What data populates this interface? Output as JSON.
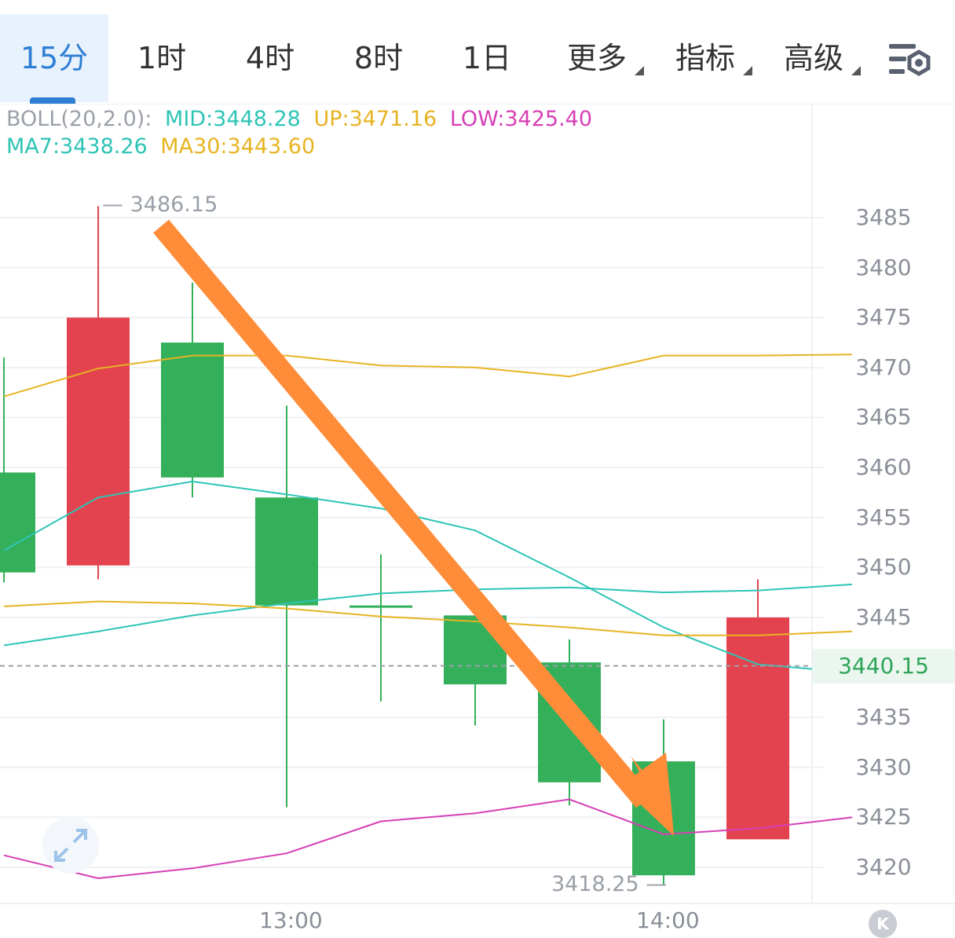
{
  "tabs": [
    {
      "label": "15分",
      "active": true
    },
    {
      "label": "1时"
    },
    {
      "label": "4时"
    },
    {
      "label": "8时"
    },
    {
      "label": "1日"
    },
    {
      "label": "更多",
      "dropdown": true
    },
    {
      "label": "指标",
      "dropdown": true
    },
    {
      "label": "高级",
      "dropdown": true
    }
  ],
  "toolbar": {
    "settings_icon": "chart-settings-icon"
  },
  "legend": {
    "boll_prefix": "BOLL(20,2.0):",
    "mid": "MID:3448.28",
    "up": "UP:3471.16",
    "low": "LOW:3425.40",
    "ma7": "MA7:3438.26",
    "ma30": "MA30:3443.60"
  },
  "colors": {
    "up_candle": "#e3434f",
    "down_candle": "#35b05a",
    "mid": "#2ec4b6",
    "up": "#e6b422",
    "low": "#d63fb5",
    "ma7": "#2ec4b6",
    "ma30": "#e6b422",
    "arrow": "#ff8c38",
    "tab_active": "#2f7fd4"
  },
  "chart_data": {
    "type": "candlestick",
    "ylim": [
      3417,
      3489
    ],
    "y_ticks": [
      3485,
      3480,
      3475,
      3470,
      3465,
      3460,
      3455,
      3450,
      3445,
      3435,
      3430,
      3425,
      3420
    ],
    "x_labels": [
      "13:00",
      "14:00"
    ],
    "last_price": "3440.15",
    "max_label": "3486.15",
    "min_label": "3418.25",
    "candles": [
      {
        "open": 3449.5,
        "close": 3459.5,
        "high": 3471,
        "low": 3448.5,
        "color": "green"
      },
      {
        "open": 3475.0,
        "close": 3450.2,
        "high": 3486.15,
        "low": 3448.8,
        "color": "red"
      },
      {
        "open": 3459.0,
        "close": 3472.5,
        "high": 3478.5,
        "low": 3457.0,
        "color": "green"
      },
      {
        "open": 3446.2,
        "close": 3457.0,
        "high": 3466.2,
        "low": 3426.0,
        "color": "green"
      },
      {
        "open": 3446.0,
        "close": 3446.2,
        "high": 3451.3,
        "low": 3436.6,
        "color": "green"
      },
      {
        "open": 3438.3,
        "close": 3445.2,
        "high": 3445.2,
        "low": 3434.2,
        "color": "green"
      },
      {
        "open": 3428.5,
        "close": 3440.5,
        "high": 3442.8,
        "low": 3426.2,
        "color": "green"
      },
      {
        "open": 3419.2,
        "close": 3430.6,
        "high": 3434.8,
        "low": 3418.25,
        "color": "green"
      },
      {
        "open": 3445.0,
        "close": 3422.8,
        "high": 3448.8,
        "low": 3422.8,
        "color": "red"
      }
    ],
    "series": [
      {
        "name": "UP",
        "values": [
          3467.1,
          3469.9,
          3471.2,
          3471.2,
          3470.2,
          3470.0,
          3469.1,
          3471.2,
          3471.2,
          3471.3
        ]
      },
      {
        "name": "MID",
        "values": [
          3442.2,
          3443.6,
          3445.2,
          3446.4,
          3447.4,
          3447.8,
          3448.0,
          3447.5,
          3447.7,
          3448.3
        ]
      },
      {
        "name": "LOW",
        "values": [
          3421.2,
          3418.9,
          3419.9,
          3421.4,
          3424.6,
          3425.4,
          3426.8,
          3423.3,
          3423.9,
          3425.0
        ]
      },
      {
        "name": "MA7",
        "values": [
          3451.7,
          3457.0,
          3458.6,
          3457.3,
          3455.9,
          3453.7,
          3449.0,
          3444.0,
          3440.3,
          3439.5
        ]
      },
      {
        "name": "MA30",
        "values": [
          3446.1,
          3446.6,
          3446.4,
          3445.9,
          3445.1,
          3444.6,
          3444.0,
          3443.2,
          3443.2,
          3443.6
        ]
      }
    ]
  },
  "controls": {
    "expand_icon": "expand-arrows-icon",
    "k_label": "K"
  }
}
